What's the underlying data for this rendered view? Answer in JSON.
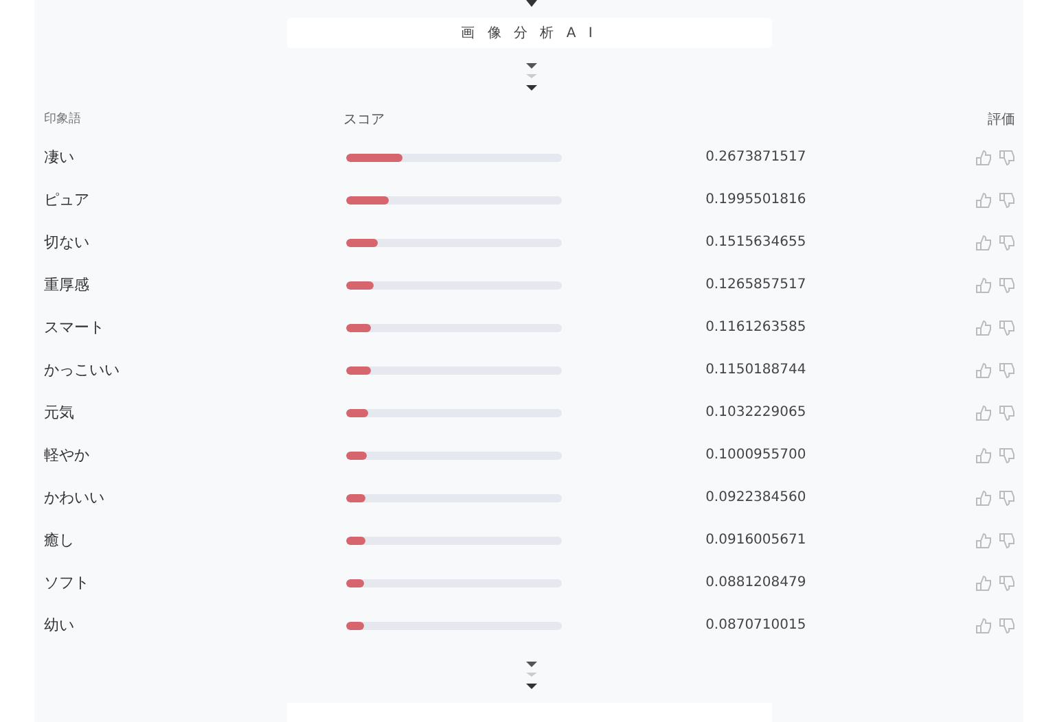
{
  "title": "画 像 分 析 A I",
  "columns": {
    "word": "印象語",
    "score": "スコア",
    "rating": "評価"
  },
  "rows": [
    {
      "word": "凄い",
      "level": 0.267,
      "score": "0.2673871517"
    },
    {
      "word": "ピュア",
      "level": 0.2,
      "score": "0.1995501816"
    },
    {
      "word": "切ない",
      "level": 0.152,
      "score": "0.1515634655"
    },
    {
      "word": "重厚感",
      "level": 0.127,
      "score": "0.1265857517"
    },
    {
      "word": "スマート",
      "level": 0.116,
      "score": "0.1161263585"
    },
    {
      "word": "かっこいい",
      "level": 0.115,
      "score": "0.1150188744"
    },
    {
      "word": "元気",
      "level": 0.103,
      "score": "0.1032229065"
    },
    {
      "word": "軽やか",
      "level": 0.1,
      "score": "0.1000955700"
    },
    {
      "word": "かわいい",
      "level": 0.092,
      "score": "0.0922384560"
    },
    {
      "word": "癒し",
      "level": 0.092,
      "score": "0.0916005671"
    },
    {
      "word": "ソフト",
      "level": 0.088,
      "score": "0.0881208479"
    },
    {
      "word": "幼い",
      "level": 0.087,
      "score": "0.0870710015"
    }
  ]
}
